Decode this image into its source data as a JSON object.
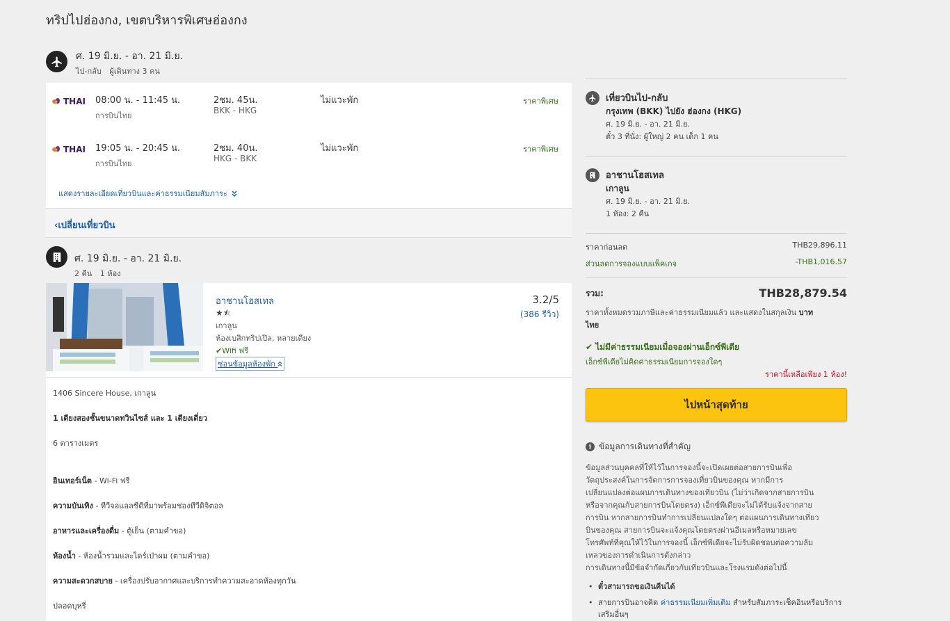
{
  "page": {
    "title": "ทริปไปฮ่องกง, เขตบริหารพิเศษฮ่องกง"
  },
  "flight_section": {
    "dates": "ศ. 19 มิ.ย. - อา. 21 มิ.ย.",
    "trip_type": "ไป-กลับ",
    "travelers": "ผู้เดินทาง 3 คน",
    "flights": [
      {
        "logo": "THAI",
        "time": "08:00 น. - 11:45 น.",
        "airline": "การบินไทย",
        "duration": "2ชม. 45น.",
        "route": "BKK - HKG",
        "stops": "ไม่แวะพัก",
        "price_label": "ราคาพิเศษ"
      },
      {
        "logo": "THAI",
        "time": "19:05 น. - 20:45 น.",
        "airline": "การบินไทย",
        "duration": "2ชม. 40น.",
        "route": "HKG - BKK",
        "stops": "ไม่แวะพัก",
        "price_label": "ราคาพิเศษ"
      }
    ],
    "details_link": "แสดงรายละเอียดเที่ยวบินและค่าธรรมเนียมสัมภาระ",
    "change_link": "เปลี่ยนเที่ยวบิน"
  },
  "hotel_section": {
    "dates": "ศ. 19 มิ.ย. - อา. 21 มิ.ย.",
    "nights": "2 คืน",
    "rooms": "1 ห้อง",
    "hotel": {
      "name": "อาชานโฮสเทล",
      "stars": "★⯪",
      "star_rating": 1.5,
      "area": "เกาลูน",
      "room_type": "ห้องเบสิกทริปเปิล, หลายเตียง",
      "wifi": "Wifi ฟรี",
      "hide_info": "ซ่อนข้อมูลห้องพัก",
      "score": "3.2/5",
      "reviews": "(386 รีวิว)"
    },
    "details": {
      "address": "1406 Sincere House, เกาลูน",
      "beds": "1 เตียงสองชั้นขนาดทวินไซส์ และ 1 เตียงเดี่ยว",
      "size": "6 ตารางเมตร",
      "internet_label": "อินเทอร์เน็ต",
      "internet_value": " - Wi-Fi ฟรี",
      "entertainment_label": "ความบันเทิง",
      "entertainment_value": " - ทีวีจอแอลซีดีที่มาพร้อมช่องทีวีดิจิตอล",
      "food_label": "อาหารและเครื่องดื่ม",
      "food_value": " - ตู้เย็น (ตามคำขอ)",
      "bathroom_label": "ห้องน้ำ",
      "bathroom_value": " - ห้องน้ำรวมและไดร์เป่าผม (ตามคำขอ)",
      "comfort_label": "ความสะดวกสบาย",
      "comfort_value": " - เครื่องปรับอากาศและบริการทำความสะอาดห้องทุกวัน",
      "smoking": "ปลอดบุหรี่"
    }
  },
  "sidebar": {
    "flight": {
      "title": "เที่ยวบินไป-กลับ",
      "route": "กรุงเทพ (BKK) ไปยัง ฮ่องกง (HKG)",
      "dates": "ศ. 19 มิ.ย. - อา. 21 มิ.ย.",
      "tickets": "ตั๋ว 3 ที่นั่ง: ผู้ใหญ่ 2 คน เด็ก 1 คน"
    },
    "hotel": {
      "title": "อาชานโฮสเทล",
      "area": "เกาลูน",
      "dates": "ศ. 19 มิ.ย. - อา. 21 มิ.ย.",
      "rooms": "1 ห้อง: 2 คืน"
    },
    "price_before_label": "ราคาก่อนลด",
    "price_before_value": "THB29,896.11",
    "discount_label": "ส่วนลดการจองแบบแพ็คเกจ",
    "discount_value": "-THB1,016.57",
    "total_label": "รวม:",
    "total_value": "THB28,879.54",
    "total_note": "ราคาทั้งหมดรวมภาษีและค่าธรรมเนียมแล้ว และแสดงในสกุลเงิน ",
    "total_note_currency_1": "บาท",
    "total_note_currency_2": "ไทย",
    "no_fee_title": "ไม่มีค่าธรรมเนียมเมื่อจองผ่านเอ็กซ์พีเดีย",
    "no_fee_sub": "เอ็กซ์พีเดียไม่คิดค่าธรรมเนียมการจองใดๆ",
    "last_room": "ราคานี้เหลือเพียง 1 ห้อง!",
    "checkout_button": "ไปหน้าสุดท้าย",
    "info_heading": "ข้อมูลการเดินทางที่สำคัญ",
    "info_lines": [
      "ข้อมูลส่วนบุคคลที่ให้ไว้ในการจองนี้จะเปิดเผยต่อสายการบินเพื่อ",
      "วัตถุประสงค์ในการจัดการการจองเที่ยวบินของคุณ หากมีการ",
      "เปลี่ยนแปลงต่อแผนการเดินทางของเที่ยวบิน (ไม่ว่าเกิดจากสายการบิน",
      "หรือจากคุณกับสายการบินโดยตรง) เอ็กซ์พีเดียจะไม่ได้รับแจ้งจากสาย",
      "การบิน หากสายการบินทำการเปลี่ยนแปลงใดๆ ต่อแผนการเดินทางเที่ยว",
      "บินของคุณ สายการบินจะแจ้งคุณโดยตรงผ่านอีเมลหรือหมายเลข",
      "โทรศัพท์ที่คุณให้ไว้ในการจองนี้ เอ็กซ์พีเดียจะไม่รับผิดชอบต่อความล้ม",
      "เหลวของการดำเนินการดังกล่าว",
      "การเดินทางนี้มีข้อจำกัดเกี่ยวกับเที่ยวบินและโรงแรมดังต่อไปนี้"
    ],
    "bullet_1": "ตั๋วสามารถขอเงินคืนได้",
    "bullet_2_pre": "สายการบินอาจคิด ",
    "bullet_2_link": "ค่าธรรมเนียมเพิ่มเติม",
    "bullet_2_post": " สำหรับสัมภาระเช็คอินหรือบริการเสริมอื่นๆ"
  },
  "icons": {
    "flight_section_icon": "airplane-icon",
    "hotel_section_icon": "building-icon",
    "details_link_icon": "chevron-double-down-icon",
    "change_link_icon": "chevron-left-icon",
    "wifi_check_icon": "checkmark-icon",
    "hide_info_icon": "chevron-double-up-icon",
    "info_icon": "info-icon"
  },
  "colors": {
    "link_blue": "#1c5fa8",
    "green": "#3a6e1e",
    "red": "#c8102e",
    "button_yellow": "#fcc30f"
  }
}
